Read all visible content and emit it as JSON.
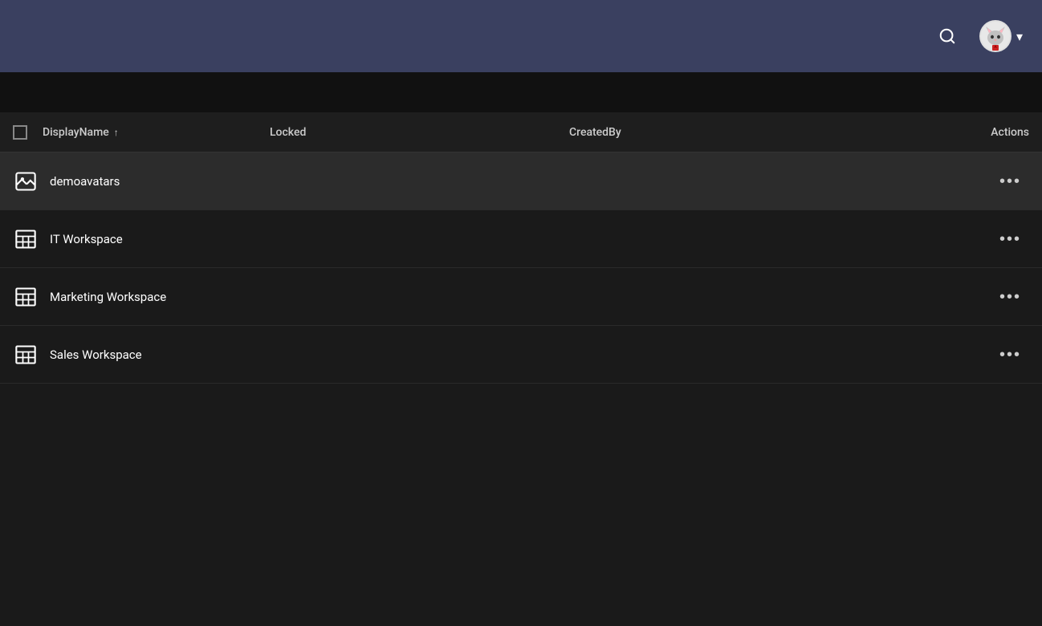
{
  "header": {
    "search_icon": "🔍",
    "user_avatar_emoji": "🐱",
    "chevron_icon": "▾"
  },
  "table": {
    "columns": [
      {
        "key": "displayName",
        "label": "DisplayName",
        "sortable": true,
        "sort_direction": "asc"
      },
      {
        "key": "locked",
        "label": "Locked",
        "sortable": false
      },
      {
        "key": "createdBy",
        "label": "CreatedBy",
        "sortable": false
      },
      {
        "key": "actions",
        "label": "Actions",
        "sortable": false
      }
    ],
    "rows": [
      {
        "id": 1,
        "name": "demoavatars",
        "icon_type": "image",
        "locked": "",
        "createdBy": "",
        "selected": true
      },
      {
        "id": 2,
        "name": "IT Workspace",
        "icon_type": "workspace",
        "locked": "",
        "createdBy": "",
        "selected": false
      },
      {
        "id": 3,
        "name": "Marketing Workspace",
        "icon_type": "workspace",
        "locked": "",
        "createdBy": "",
        "selected": false
      },
      {
        "id": 4,
        "name": "Sales Workspace",
        "icon_type": "workspace",
        "locked": "",
        "createdBy": "",
        "selected": false
      }
    ],
    "actions_dots_label": "•••"
  }
}
